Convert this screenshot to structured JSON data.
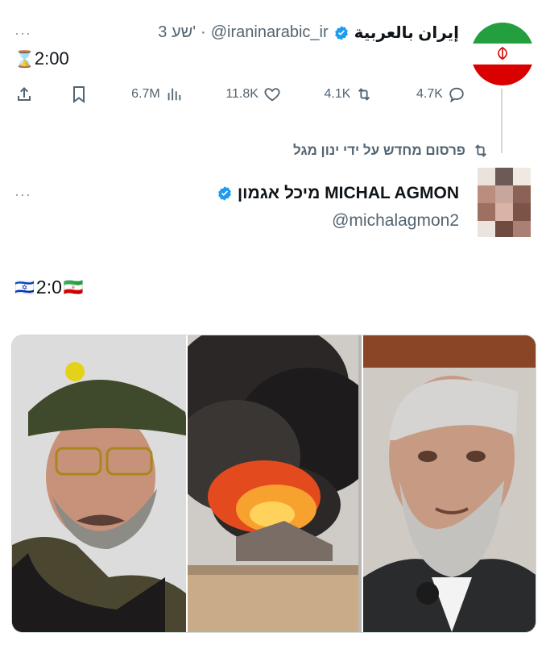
{
  "tweet1": {
    "display_name": "إيران بالعربية",
    "handle": "@iraninarabic_ir",
    "time": "3 שע'",
    "separator": "·",
    "text": "2:00",
    "hourglass": "⌛",
    "stats": {
      "views": "6.7M",
      "likes": "11.8K",
      "retweets": "4.1K",
      "replies": "4.7K"
    }
  },
  "repost_label": "פרסום מחדש על ידי ינון מגל",
  "tweet2": {
    "display_name": "מיכל אגמון MICHAL AGMON",
    "handle": "@michalagmon2",
    "text": "2:0",
    "flag_left": "🇮🇱",
    "flag_right": "🇮🇷"
  },
  "more_icon": "···",
  "colors": {
    "verified": "#1d9bf0",
    "text": "#0f1419",
    "muted": "#536471",
    "iran_green": "#239f40",
    "iran_red": "#da0000"
  }
}
